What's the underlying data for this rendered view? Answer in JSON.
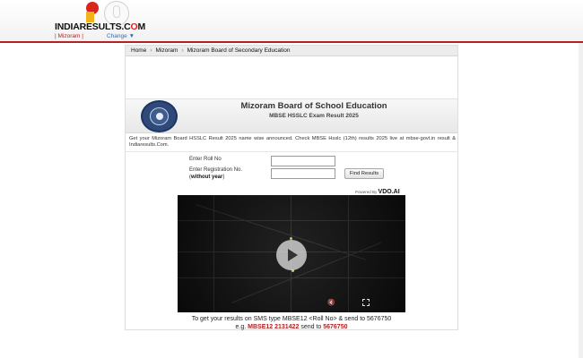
{
  "header": {
    "logo_text_main": "INDIARESULTS.C",
    "logo_text_accent": "O",
    "logo_text_end": "M",
    "state_label": "| Mizoram  |",
    "change_label": "Change ▼"
  },
  "breadcrumb": {
    "items": [
      "Home",
      "Mizoram",
      "Mizoram Board of Secondary Education"
    ],
    "separator": "›"
  },
  "board": {
    "title": "Mizoram Board of School Education",
    "subtitle": "MBSE HSSLC Exam Result 2025"
  },
  "intro_text": "Get your Mizoram Board HSSLC Result 2025 name wise announced. Check MBSE Hsslc (12th) results 2025 live at mbse-govt.in result & Indiaresults.Com.",
  "form": {
    "roll_label": "Enter Roll No",
    "reg_label": "Enter Registration No.",
    "reg_note_open": "(",
    "reg_note_bold": "without year",
    "reg_note_close": ")",
    "roll_value": "",
    "reg_value": "",
    "submit_label": "Find Results"
  },
  "video": {
    "powered_by": "Powered By",
    "provider": "VDO.AI"
  },
  "sms": {
    "line1": "To get your results on SMS type MBSE12 <Roll No> & send to 5676750",
    "eg_prefix": "e.g.",
    "eg_code": "MBSE12  2131422",
    "eg_mid": "send to",
    "eg_number": "5676750"
  },
  "colors": {
    "accent_red": "#b22222",
    "link_blue": "#2a6cbf",
    "seal_blue": "#2f4a7a"
  }
}
